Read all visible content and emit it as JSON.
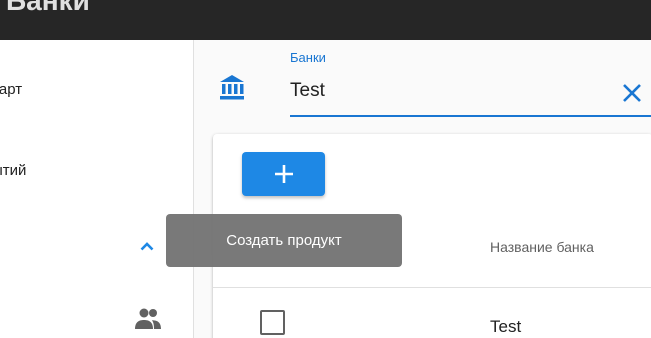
{
  "app": {
    "title": "Банки"
  },
  "sidebar": {
    "items": [
      {
        "label": "карт",
        "icon": ""
      },
      {
        "label": "ытий",
        "icon": ""
      },
      {
        "label": "",
        "icon": "chevron-up-icon",
        "expanded": true
      },
      {
        "label": "",
        "icon": "people-icon"
      }
    ]
  },
  "filter": {
    "label": "Банки",
    "value": "Test",
    "icon": "bank-icon",
    "clear_icon": "close-icon"
  },
  "toolbar": {
    "add_icon": "plus-icon",
    "add_tooltip": "Создать продукт"
  },
  "table": {
    "columns": [
      "Название банка"
    ],
    "rows": [
      {
        "checked": false,
        "cells": [
          "Test"
        ]
      }
    ]
  },
  "colors": {
    "primary": "#1e88e5",
    "accent_label": "#1976d2",
    "app_bar": "#262626",
    "tooltip_bg": "#757575"
  }
}
